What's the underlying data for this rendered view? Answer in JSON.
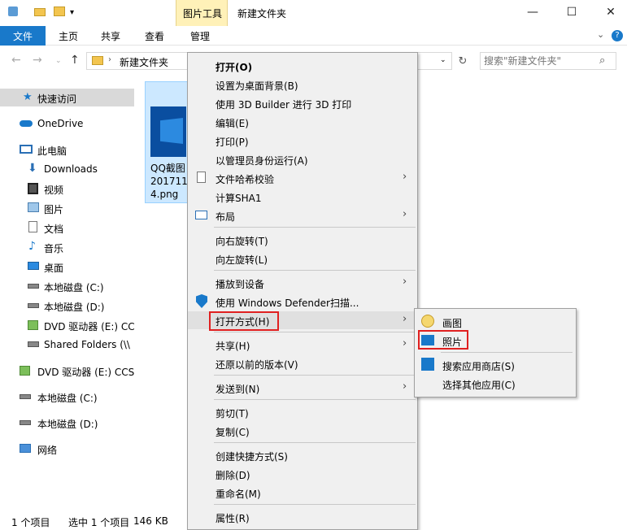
{
  "window": {
    "picture_tools_tab": "图片工具",
    "title": "新建文件夹",
    "minimize": "—",
    "maximize": "☐",
    "close": "✕"
  },
  "ribbon": {
    "file": "文件",
    "tabs": [
      "主页",
      "共享",
      "查看",
      "管理"
    ],
    "expand": "⌄",
    "help": "?"
  },
  "address": {
    "back": "←",
    "forward": "→",
    "recent": "⌄",
    "up": "↑",
    "separator": "›",
    "crumb": "新建文件夹",
    "dropdown": "⌄",
    "refresh": "↻"
  },
  "search": {
    "placeholder": "搜索\"新建文件夹\"",
    "icon": "⌕"
  },
  "sidebar": {
    "items": [
      {
        "label": "快速访问",
        "icon": "star-icon"
      },
      {
        "label": "OneDrive",
        "icon": "cloud-icon"
      },
      {
        "label": "此电脑",
        "icon": "computer-icon"
      },
      {
        "label": "Downloads",
        "icon": "download-icon"
      },
      {
        "label": "视频",
        "icon": "video-icon"
      },
      {
        "label": "图片",
        "icon": "picture-icon"
      },
      {
        "label": "文档",
        "icon": "document-icon"
      },
      {
        "label": "音乐",
        "icon": "music-icon"
      },
      {
        "label": "桌面",
        "icon": "desktop-icon"
      },
      {
        "label": "本地磁盘 (C:)",
        "icon": "drive-icon"
      },
      {
        "label": "本地磁盘 (D:)",
        "icon": "drive-icon"
      },
      {
        "label": "DVD 驱动器 (E:) CC",
        "icon": "dvd-icon"
      },
      {
        "label": "Shared Folders (\\\\",
        "icon": "network-drive-icon"
      },
      {
        "label": "DVD 驱动器 (E:) CCS",
        "icon": "dvd-icon"
      },
      {
        "label": "本地磁盘 (C:)",
        "icon": "drive-icon"
      },
      {
        "label": "本地磁盘 (D:)",
        "icon": "drive-icon"
      },
      {
        "label": "网络",
        "icon": "network-icon"
      }
    ]
  },
  "file": {
    "name": "QQ截图\n201711\n4.png"
  },
  "status": {
    "count": "1 个项目",
    "selected": "选中 1 个项目",
    "size": "146 KB"
  },
  "context_menu": {
    "open": "打开(O)",
    "set_desktop_bg": "设置为桌面背景(B)",
    "print_3d": "使用 3D Builder 进行 3D 打印",
    "edit": "编辑(E)",
    "print": "打印(P)",
    "run_as_admin": "以管理员身份运行(A)",
    "file_hash": "文件哈希校验",
    "calc_sha1": "计算SHA1",
    "layout": "布局",
    "rotate_right": "向右旋转(T)",
    "rotate_left": "向左旋转(L)",
    "cast_to_device": "播放到设备",
    "defender_scan": "使用 Windows Defender扫描...",
    "open_with": "打开方式(H)",
    "share": "共享(H)",
    "restore_versions": "还原以前的版本(V)",
    "send_to": "发送到(N)",
    "cut": "剪切(T)",
    "copy": "复制(C)",
    "create_shortcut": "创建快捷方式(S)",
    "delete": "删除(D)",
    "rename": "重命名(M)",
    "properties": "属性(R)",
    "arrow": "›"
  },
  "open_with_submenu": {
    "paint": "画图",
    "photos": "照片",
    "search_store": "搜索应用商店(S)",
    "choose_other": "选择其他应用(C)"
  },
  "colors": {
    "accent": "#1979ca",
    "picture_tools": "#fff1b8",
    "highlight_box": "#e02020"
  }
}
